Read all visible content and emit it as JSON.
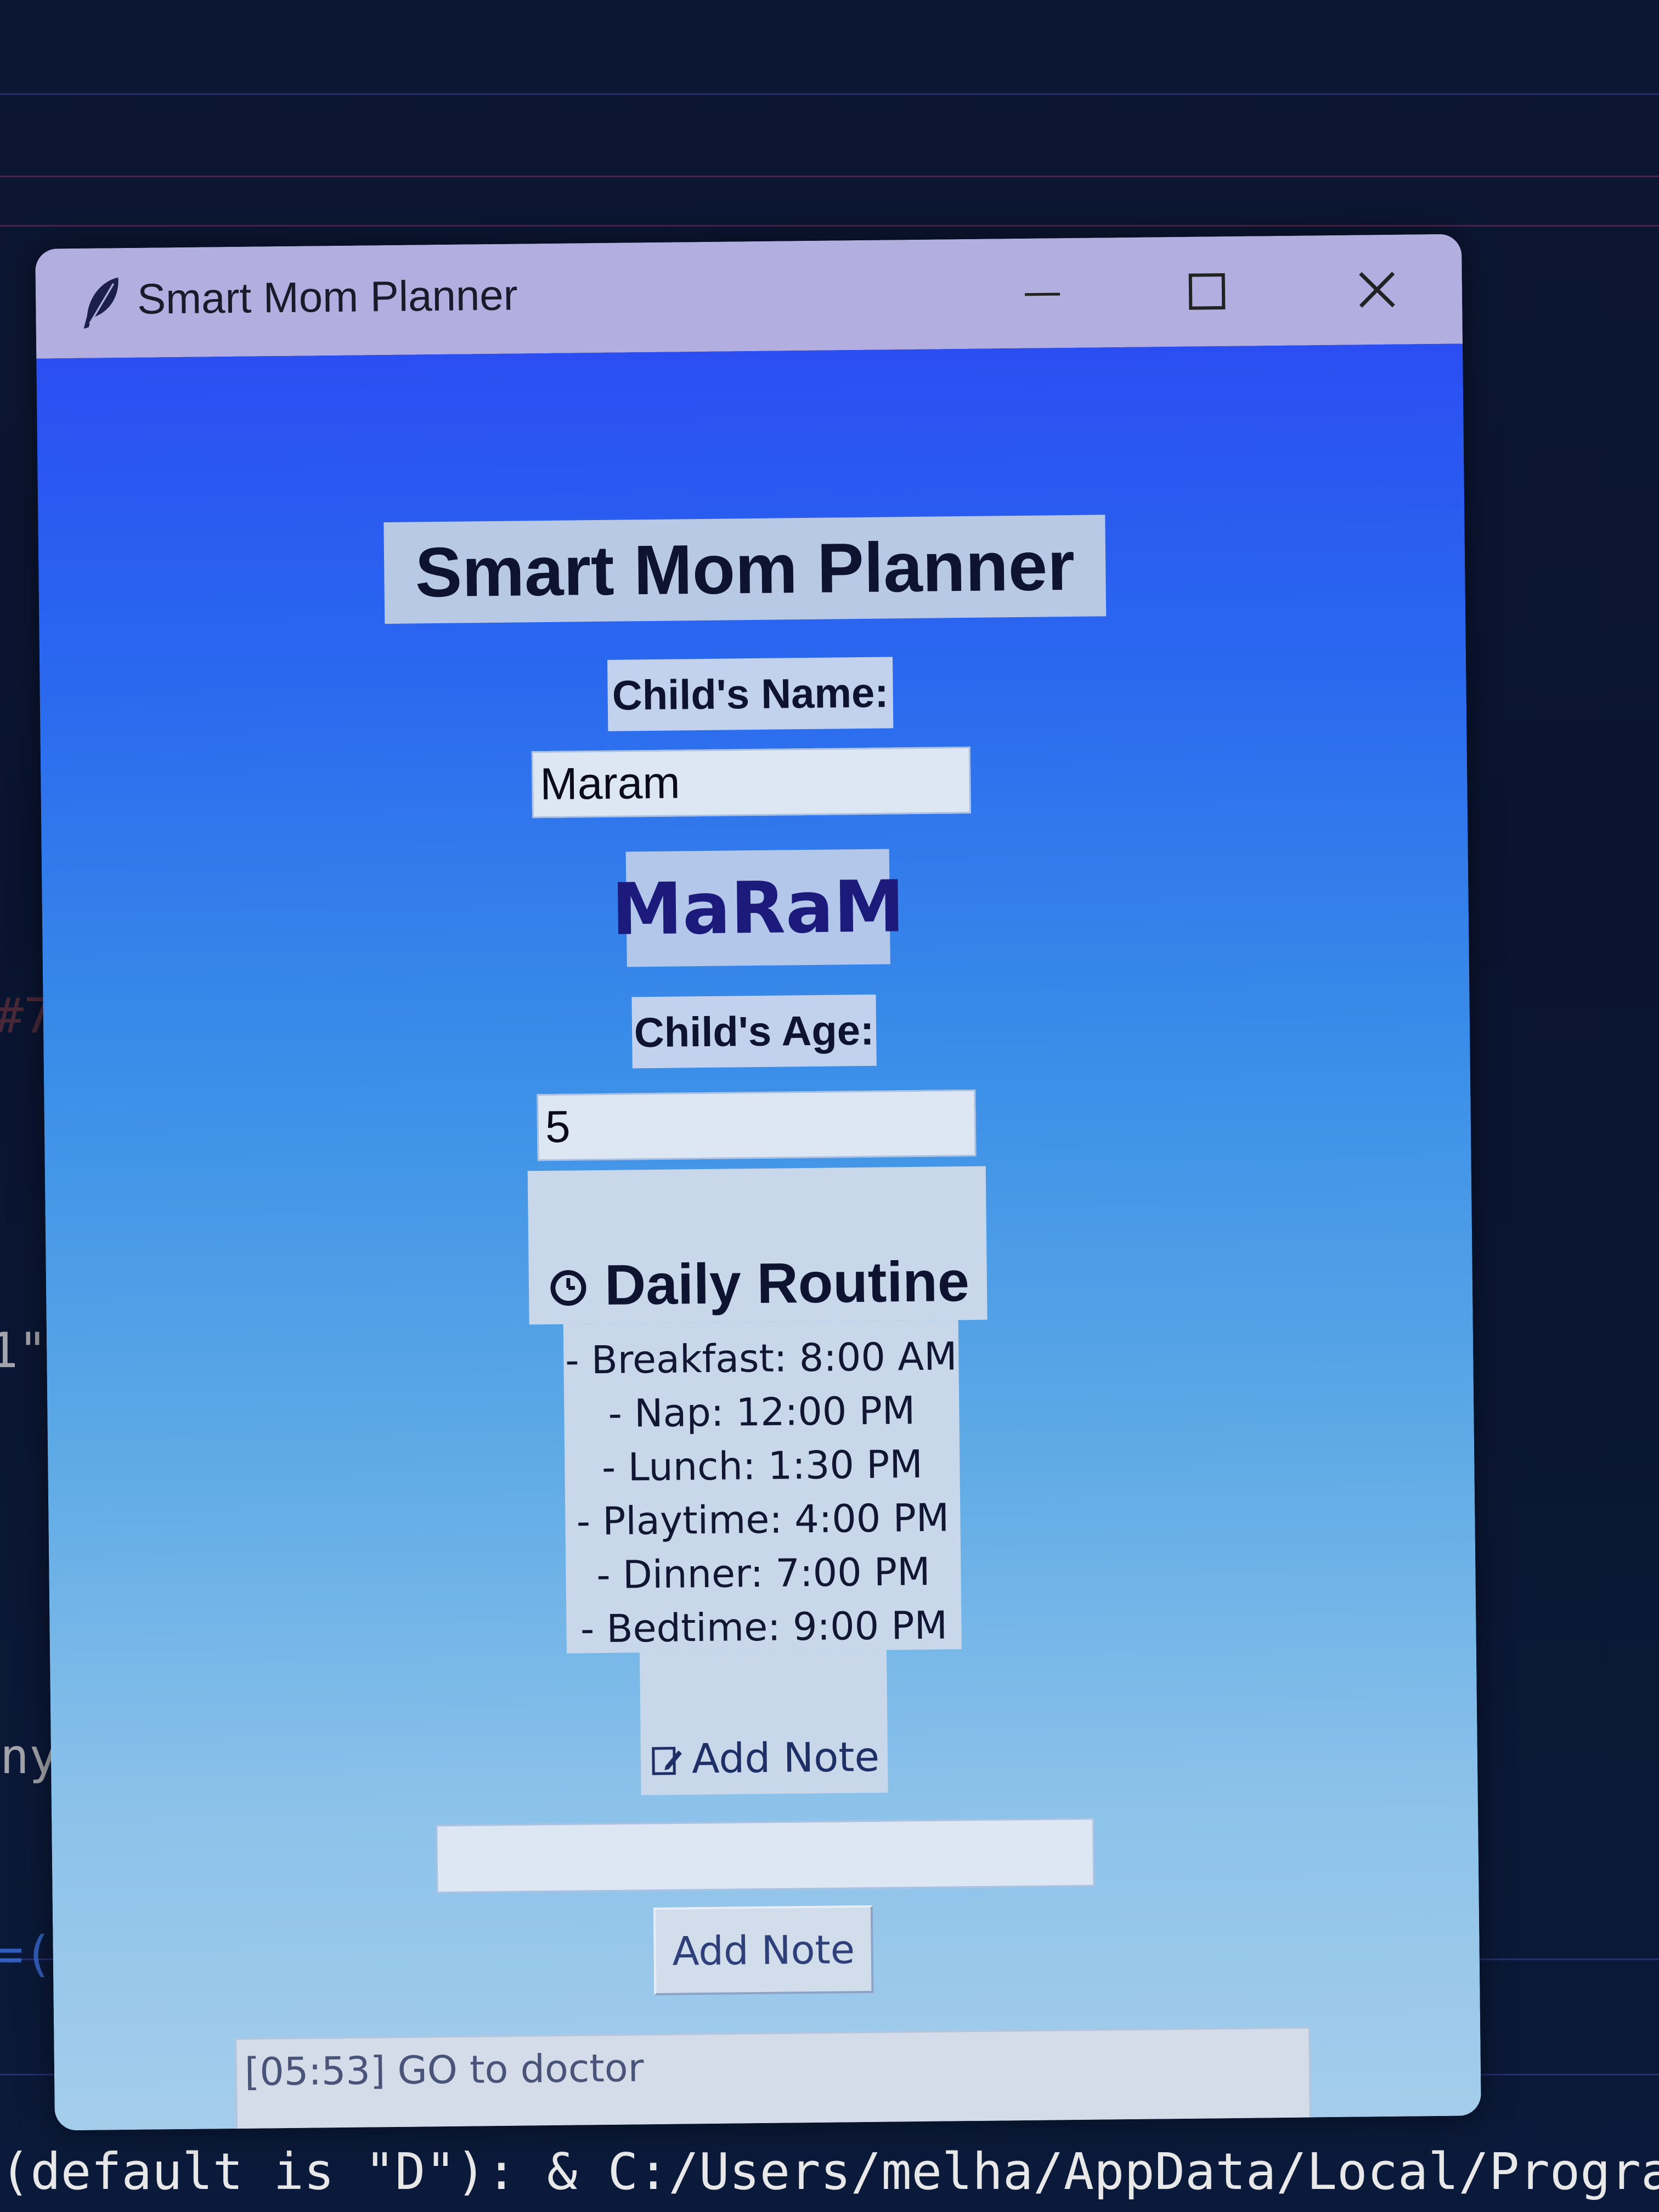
{
  "window": {
    "title": "Smart Mom Planner",
    "controls": {
      "minimize_icon": "minimize-icon",
      "maximize_icon": "maximize-icon",
      "close_icon": "close-icon"
    }
  },
  "app": {
    "heading": "Smart Mom Planner",
    "name_label": "Child's Name:",
    "name_value": "Maram",
    "name_display": "MaRaM",
    "age_label": "Child's Age:",
    "age_value": "5",
    "routine": {
      "icon": "clock-icon",
      "title": "Daily Routine",
      "items": [
        "- Breakfast: 8:00 AM",
        "- Nap: 12:00 PM",
        "- Lunch: 1:30 PM",
        "- Playtime: 4:00 PM",
        "- Dinner: 7:00 PM",
        "- Bedtime: 9:00 PM"
      ]
    },
    "note_label": "Add Note",
    "note_label_icon": "memo-icon",
    "note_input_value": "",
    "add_note_button": "Add Note",
    "notes_log": "[05:53] GO to doctor"
  },
  "background": {
    "ide_fragments": [
      "#7",
      "1\"",
      "ny",
      "=("
    ],
    "terminal_text": "(default is \"D\"): & C:/Users/melha/AppData/Local/Programs/Python/Py"
  },
  "colors": {
    "titlebar": "#b3aee0",
    "gradient_top": "#2b4ef2",
    "gradient_bottom": "#a5cdeb",
    "label_bg": "#c9d7ea",
    "nickname_text": "#1c1a7a"
  }
}
